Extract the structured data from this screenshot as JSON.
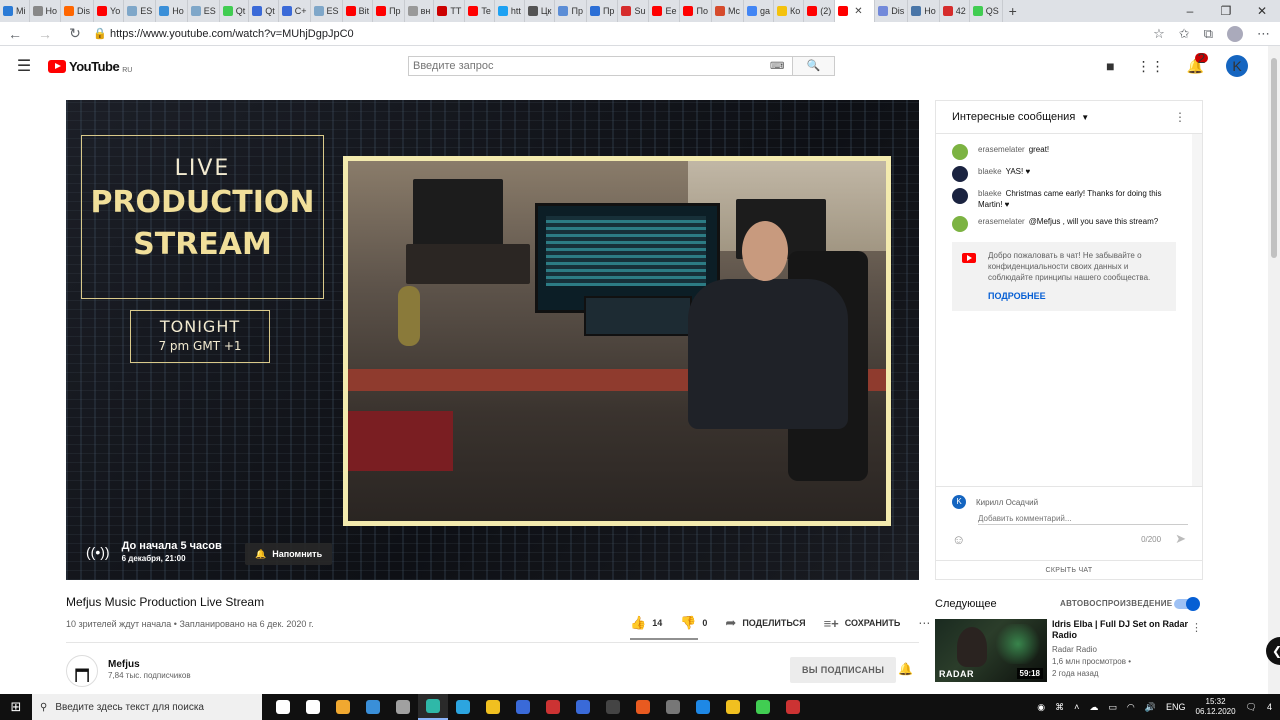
{
  "browser": {
    "tabs": [
      {
        "label": "Mi",
        "color": "#2b7bd6"
      },
      {
        "label": "Ho",
        "color": "#888888"
      },
      {
        "label": "Dis",
        "color": "#ff6600"
      },
      {
        "label": "Yo",
        "color": "#ff0000"
      },
      {
        "label": "ES",
        "color": "#7fa7c9"
      },
      {
        "label": "Ho",
        "color": "#3a8fd8"
      },
      {
        "label": "ES",
        "color": "#7fa7c9"
      },
      {
        "label": "Qt",
        "color": "#41cd52"
      },
      {
        "label": "Qt",
        "color": "#3a6ad8"
      },
      {
        "label": "C+",
        "color": "#3a6ad8"
      },
      {
        "label": "ES",
        "color": "#7fa7c9"
      },
      {
        "label": "Bit",
        "color": "#ff0000"
      },
      {
        "label": "Пр",
        "color": "#ff0000"
      },
      {
        "label": "вн",
        "color": "#999999"
      },
      {
        "label": "ТТ",
        "color": "#cc0000"
      },
      {
        "label": "Te",
        "color": "#ff0000"
      },
      {
        "label": "htt",
        "color": "#1da1f2"
      },
      {
        "label": "Цк",
        "color": "#555555"
      },
      {
        "label": "Пр",
        "color": "#5b8dd6"
      },
      {
        "label": "Пр",
        "color": "#2c6fd6"
      },
      {
        "label": "Su",
        "color": "#d62c2c"
      },
      {
        "label": "Ee",
        "color": "#ff0000"
      },
      {
        "label": "По",
        "color": "#ff0000"
      },
      {
        "label": "Mc",
        "color": "#d64b2c"
      },
      {
        "label": "ga",
        "color": "#4285f4"
      },
      {
        "label": "Ко",
        "color": "#f4c20d"
      },
      {
        "label": "(2)",
        "color": "#ff0000"
      },
      {
        "label": "",
        "color": "#ff0000",
        "active": true
      },
      {
        "label": "Dis",
        "color": "#7289da"
      },
      {
        "label": "Но",
        "color": "#4a76a8"
      },
      {
        "label": "42",
        "color": "#d62c2c"
      },
      {
        "label": "QS",
        "color": "#41cd52"
      }
    ],
    "new_tab": "+",
    "url": "https://www.youtube.com/watch?v=MUhjDgpJpC0"
  },
  "youtube": {
    "logo_text": "YouTube",
    "logo_region": "RU",
    "search_placeholder": "Введите запрос",
    "notification_count": "2",
    "user_initial": "K"
  },
  "player": {
    "promo_line1": "LIVE",
    "promo_line2": "PRODUCTION",
    "promo_line3": "STREAM",
    "tonight": "TONIGHT",
    "tonight_time": "7 pm GMT +1",
    "countdown": "До начала 5 часов",
    "scheduled": "6 декабря, 21:00",
    "remind_label": "Напомнить"
  },
  "chat": {
    "header": "Интересные сообщения",
    "messages": [
      {
        "author": "erasemelater",
        "text": "great!",
        "color": "#7cb342"
      },
      {
        "author": "blaeke",
        "text": "YAS! ♥",
        "color": "#1a2340"
      },
      {
        "author": "blaeke",
        "text": "Christmas came early! Thanks for doing this Martin! ♥",
        "color": "#1a2340"
      },
      {
        "author": "erasemelater",
        "text": "@Mefjus , will you save this stream?",
        "color": "#7cb342"
      }
    ],
    "welcome_text": "Добро пожаловать в чат! Не забывайте о конфиденциальности своих данных и соблюдайте принципы нашего сообщества.",
    "welcome_link": "ПОДРОБНЕЕ",
    "input_user": "Кирилл Осадчий",
    "input_user_initial": "K",
    "input_placeholder": "Добавить комментарий...",
    "char_count": "0/200",
    "hide_chat": "СКРЫТЬ ЧАТ"
  },
  "video": {
    "title": "Mefjus Music Production Live Stream",
    "meta": "10 зрителей ждут начала • Запланировано на 6 дек. 2020 г.",
    "likes": "14",
    "dislikes": "0",
    "share": "ПОДЕЛИТЬСЯ",
    "save": "СОХРАНИТЬ",
    "channel_name": "Mefjus",
    "channel_subs": "7,84 тыс. подписчиков",
    "subscribed": "ВЫ ПОДПИСАНЫ"
  },
  "upnext": {
    "label": "Следующее",
    "autoplay": "АВТОВОСПРОИЗВЕДЕНИЕ",
    "autoplay_on": true,
    "item": {
      "title": "Idris Elba | Full DJ Set on Radar Radio",
      "channel": "Radar Radio",
      "views": "1,6 млн просмотров •",
      "age": "2 года назад",
      "duration": "59:18",
      "thumb_brand": "RADAR"
    }
  },
  "taskbar": {
    "search_placeholder": "Введите здесь текст для поиска",
    "lang": "ENG",
    "time": "15:32",
    "date": "06.12.2020",
    "notif": "4",
    "apps": [
      {
        "name": "cortana",
        "color": "#ffffff"
      },
      {
        "name": "task-view",
        "color": "#ffffff"
      },
      {
        "name": "store",
        "color": "#f0a830"
      },
      {
        "name": "mail",
        "color": "#3a8fd8"
      },
      {
        "name": "gimp",
        "color": "#a0a0a0"
      },
      {
        "name": "edge",
        "color": "#2fb8a8",
        "active": true
      },
      {
        "name": "telegram",
        "color": "#2ca5e0"
      },
      {
        "name": "app-yellow",
        "color": "#f0c020"
      },
      {
        "name": "monitor",
        "color": "#3a6ad8"
      },
      {
        "name": "ide",
        "color": "#cc3333"
      },
      {
        "name": "app-blue-circle",
        "color": "#3a6ad8"
      },
      {
        "name": "terminal",
        "color": "#444444"
      },
      {
        "name": "app-orange",
        "color": "#e85a20"
      },
      {
        "name": "app-grey",
        "color": "#777777"
      },
      {
        "name": "vscode",
        "color": "#1e88e5"
      },
      {
        "name": "app-triangle",
        "color": "#f0c020"
      },
      {
        "name": "qt-creator",
        "color": "#41cd52"
      },
      {
        "name": "app-red",
        "color": "#cc3333"
      }
    ]
  }
}
